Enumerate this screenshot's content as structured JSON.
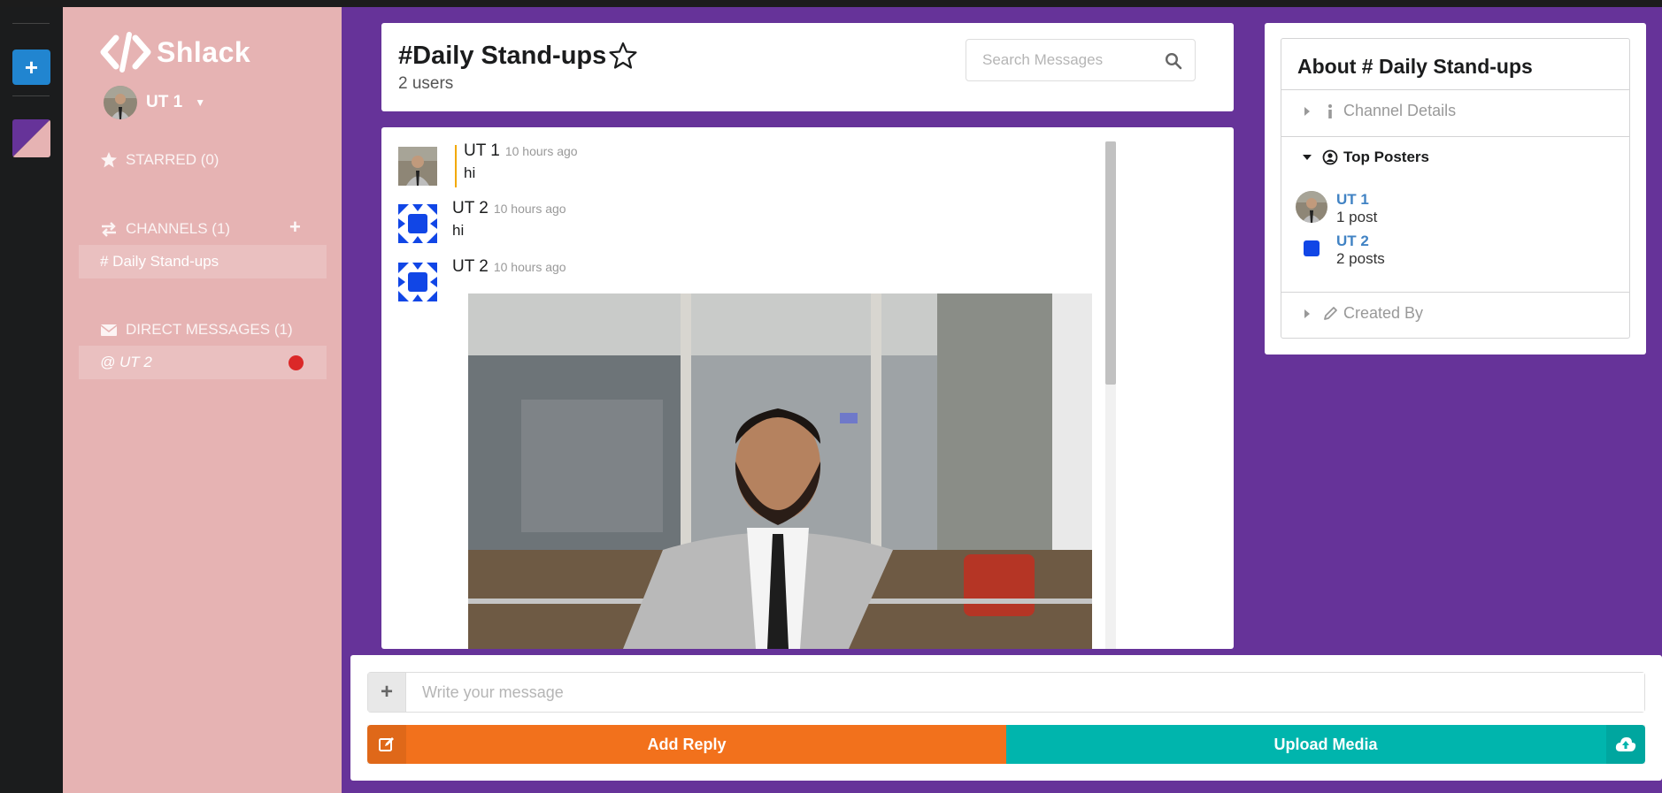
{
  "colors": {
    "page_bg": "#663399",
    "sidebar_bg": "#e6b3b3",
    "color_panel_bg": "#1b1c1d",
    "add_button": "#2185d0",
    "reply_button": "#f2711c",
    "upload_button": "#00b5ad",
    "notification_dot": "#db2828",
    "link": "#4183c4"
  },
  "app": {
    "brand": "Shlack",
    "logo_icon": "code-icon"
  },
  "current_user": {
    "name": "UT 1"
  },
  "sidebar": {
    "starred": {
      "label": "STARRED (0)",
      "icon": "star-icon"
    },
    "channels": {
      "label": "CHANNELS (1)",
      "icon": "exchange-icon",
      "add_icon": "plus-icon",
      "items": [
        {
          "label": "# Daily Stand-ups"
        }
      ]
    },
    "direct_messages": {
      "label": "DIRECT MESSAGES (1)",
      "icon": "mail-icon",
      "items": [
        {
          "label": "@ UT 2",
          "status": "offline"
        }
      ]
    }
  },
  "header": {
    "channel_name": "#Daily Stand-ups",
    "user_count": "2 users",
    "search_placeholder": "Search Messages"
  },
  "messages": [
    {
      "author": "UT 1",
      "time": "10 hours ago",
      "text": "hi",
      "is_self": true
    },
    {
      "author": "UT 2",
      "time": "10 hours ago",
      "text": "hi",
      "is_self": false
    },
    {
      "author": "UT 2",
      "time": "10 hours ago",
      "text": "",
      "has_image": true,
      "is_self": false
    }
  ],
  "meta_panel": {
    "title": "About # Daily Stand-ups",
    "sections": [
      {
        "label": "Channel Details",
        "icon": "info-icon",
        "expanded": false
      },
      {
        "label": "Top Posters",
        "icon": "user-circle-icon",
        "expanded": true
      },
      {
        "label": "Created By",
        "icon": "pencil-icon",
        "expanded": false
      }
    ],
    "top_posters": [
      {
        "name": "UT 1",
        "count": "1 post"
      },
      {
        "name": "UT 2",
        "count": "2 posts"
      }
    ]
  },
  "message_form": {
    "placeholder": "Write your message",
    "reply_label": "Add Reply",
    "upload_label": "Upload Media"
  }
}
